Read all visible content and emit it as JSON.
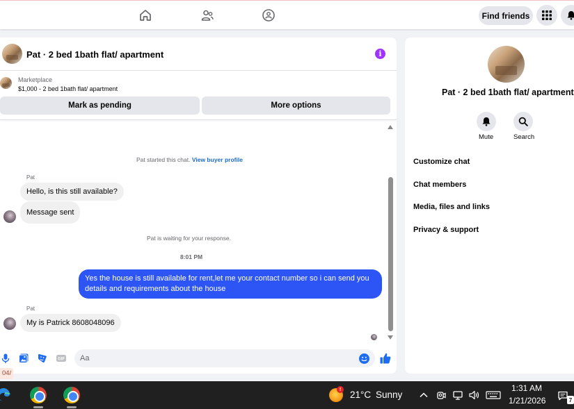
{
  "nav": {
    "find_friends": "Find friends"
  },
  "chat": {
    "title": "Pat · 2 bed 1bath flat/ apartment",
    "marketplace_label": "Marketplace",
    "listing": "$1,000 - 2 bed 1bath flat/ apartment",
    "mark_pending": "Mark as pending",
    "more_options": "More options",
    "started_text": "Pat started this chat.",
    "view_profile": "View buyer profile",
    "messages": [
      {
        "sender": "Pat",
        "text": "Hello, is this still available?"
      },
      {
        "text": "Message sent"
      }
    ],
    "waiting_text": "Pat is waiting for your response.",
    "time_separator": "8:01 PM",
    "outgoing_text": "Yes the house is still available for rent,let me your contact number so i can send you details and requirements about the house",
    "reply_sender": "Pat",
    "reply_text": "My is Patrick 8608048096",
    "input_placeholder": "Aa"
  },
  "info": {
    "name": "Pat · 2 bed 1bath flat/ apartment",
    "mute_label": "Mute",
    "search_label": "Search",
    "menu": [
      "Customize chat",
      "Chat members",
      "Media, files and links",
      "Privacy & support"
    ]
  },
  "page_tag": "04/",
  "taskbar": {
    "temperature": "21°C",
    "condition": "Sunny",
    "time": "1:31 AM",
    "date": "1/21/2026",
    "notification_count": "7",
    "weather_badge": "!"
  },
  "colors": {
    "accent_blue": "#2d55f5",
    "link_blue": "#1b6ac9",
    "info_purple": "#a033ff",
    "taskbar": "#202020"
  }
}
